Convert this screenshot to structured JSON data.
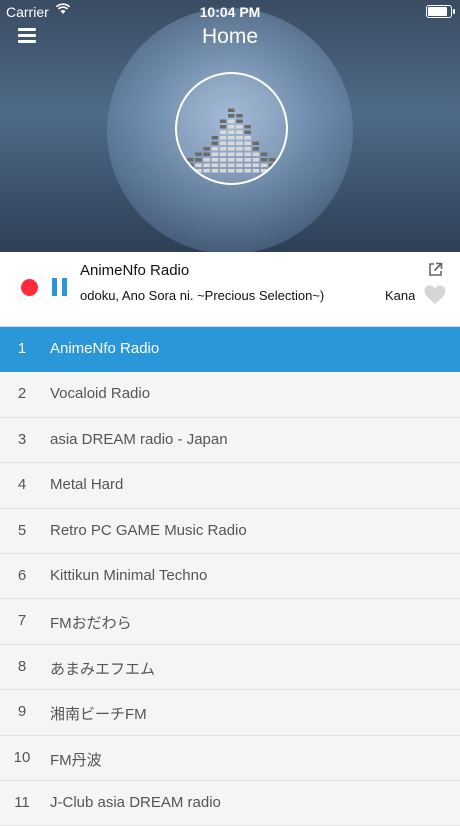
{
  "status_bar": {
    "carrier": "Carrier",
    "time": "10:04 PM"
  },
  "header": {
    "title": "Home"
  },
  "icons": {
    "menu": "hamburger-icon",
    "share": "share-icon",
    "favorite": "heart-icon",
    "record": "record-icon",
    "pause": "pause-icon",
    "wifi": "wifi-icon",
    "battery": "battery-icon"
  },
  "player": {
    "station": "AnimeNfo Radio",
    "track": "odoku, Ano Sora ni. ~Precious Selection~)",
    "track_next": "Kana"
  },
  "stations": [
    {
      "num": "1",
      "name": "AnimeNfo Radio",
      "active": true
    },
    {
      "num": "2",
      "name": "Vocaloid Radio"
    },
    {
      "num": "3",
      "name": "asia DREAM radio - Japan"
    },
    {
      "num": "4",
      "name": "Metal Hard"
    },
    {
      "num": "5",
      "name": "Retro PC GAME Music Radio"
    },
    {
      "num": "6",
      "name": "Kittikun Minimal Techno"
    },
    {
      "num": "7",
      "name": "FMおだわら"
    },
    {
      "num": "8",
      "name": "あまみエフエム"
    },
    {
      "num": "9",
      "name": "湘南ビーチFM"
    },
    {
      "num": "10",
      "name": "FM丹波"
    },
    {
      "num": "11",
      "name": "J-Club asia DREAM radio"
    }
  ],
  "colors": {
    "accent": "#2a97d9",
    "record": "#ff2d3c"
  }
}
